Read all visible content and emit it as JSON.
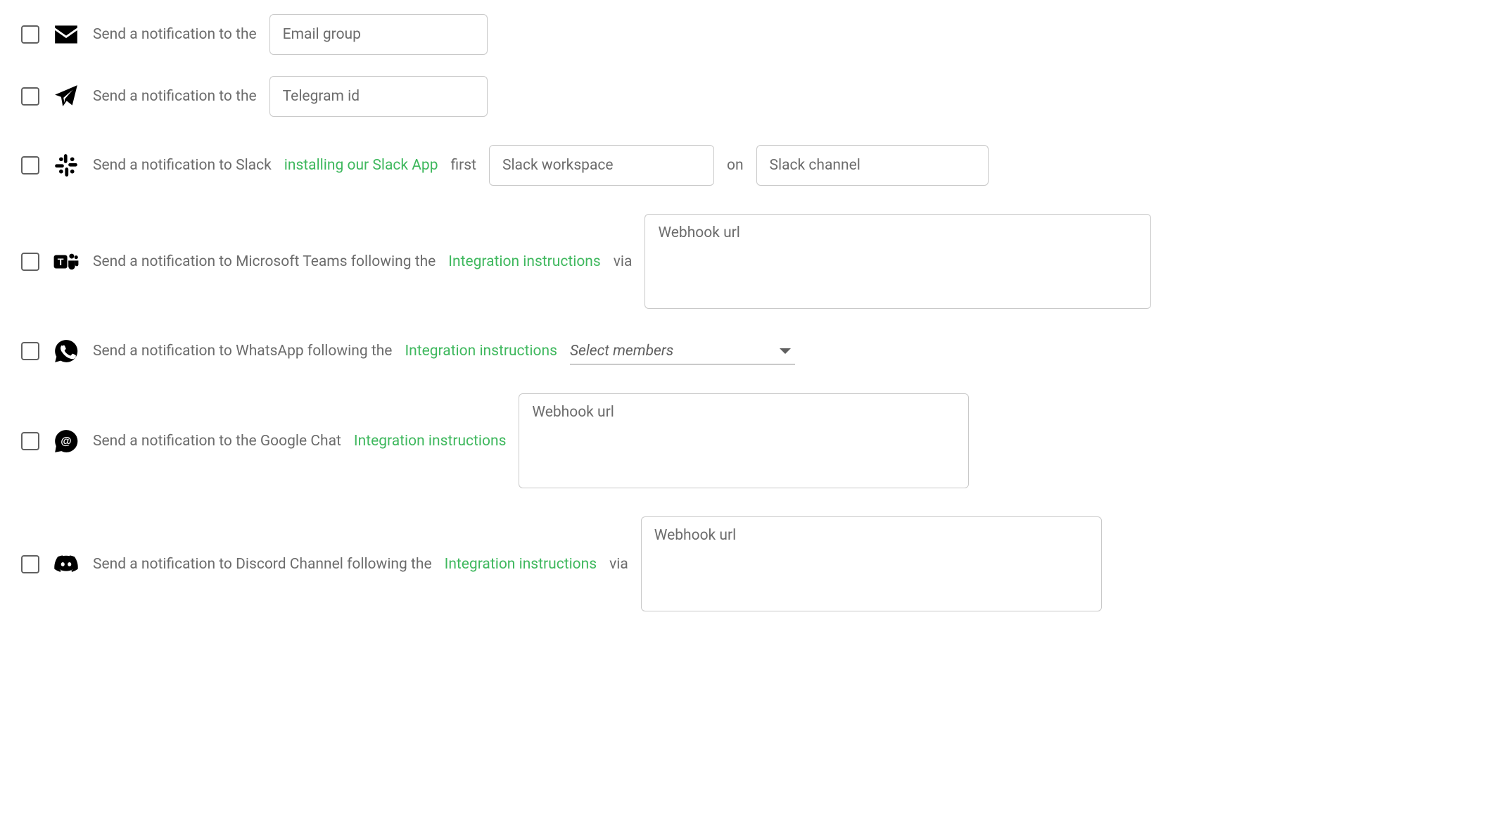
{
  "email": {
    "label": "Send a notification to the",
    "placeholder": "Email group"
  },
  "telegram": {
    "label": "Send a notification to the",
    "placeholder": "Telegram id"
  },
  "slack": {
    "label_pre": "Send a notification to Slack",
    "link": "installing our Slack App",
    "label_post": "first",
    "workspace_placeholder": "Slack workspace",
    "connector": "on",
    "channel_placeholder": "Slack channel"
  },
  "teams": {
    "label_pre": "Send a notification to Microsoft Teams following the",
    "link": "Integration instructions",
    "label_post": "via",
    "placeholder": "Webhook url"
  },
  "whatsapp": {
    "label_pre": "Send a notification to WhatsApp following the",
    "link": "Integration instructions",
    "select_placeholder": "Select members"
  },
  "gchat": {
    "label_pre": "Send a notification to the Google Chat",
    "link": "Integration instructions",
    "placeholder": "Webhook url"
  },
  "discord": {
    "label_pre": "Send a notification to Discord Channel following the",
    "link": "Integration instructions",
    "label_post": "via",
    "placeholder": "Webhook url"
  }
}
